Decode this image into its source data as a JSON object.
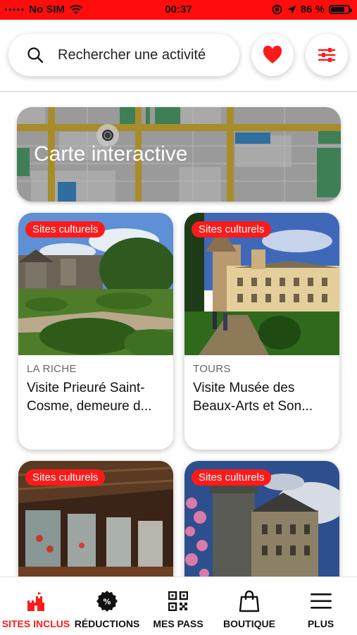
{
  "status_bar": {
    "carrier": "No SIM",
    "time": "00:37",
    "battery_text": "86 %",
    "battery_level": 0.86
  },
  "search": {
    "placeholder": "Rechercher une activité"
  },
  "header_buttons": {
    "favorites_icon": "heart-icon",
    "filters_icon": "sliders-icon"
  },
  "map_card": {
    "title": "Carte interactive"
  },
  "cards": [
    {
      "badge": "Sites culturels",
      "city": "LA RICHE",
      "name": "Visite Prieuré Saint-Cosme, demeure d..."
    },
    {
      "badge": "Sites culturels",
      "city": "TOURS",
      "name": "Visite Musée des Beaux-Arts et Son..."
    },
    {
      "badge": "Sites culturels"
    },
    {
      "badge": "Sites culturels"
    }
  ],
  "tabbar": {
    "tabs": [
      {
        "label": "SITES INCLUS",
        "icon": "castle-icon",
        "active": true
      },
      {
        "label": "RÉDUCTIONS",
        "icon": "percent-badge-icon"
      },
      {
        "label": "MES PASS",
        "icon": "qr-code-icon"
      },
      {
        "label": "BOUTIQUE",
        "icon": "shopping-bag-icon"
      },
      {
        "label": "PLUS",
        "icon": "menu-icon"
      }
    ]
  },
  "colors": {
    "accent": "#ff1a1a",
    "status_bar": "#ff0d0d"
  }
}
